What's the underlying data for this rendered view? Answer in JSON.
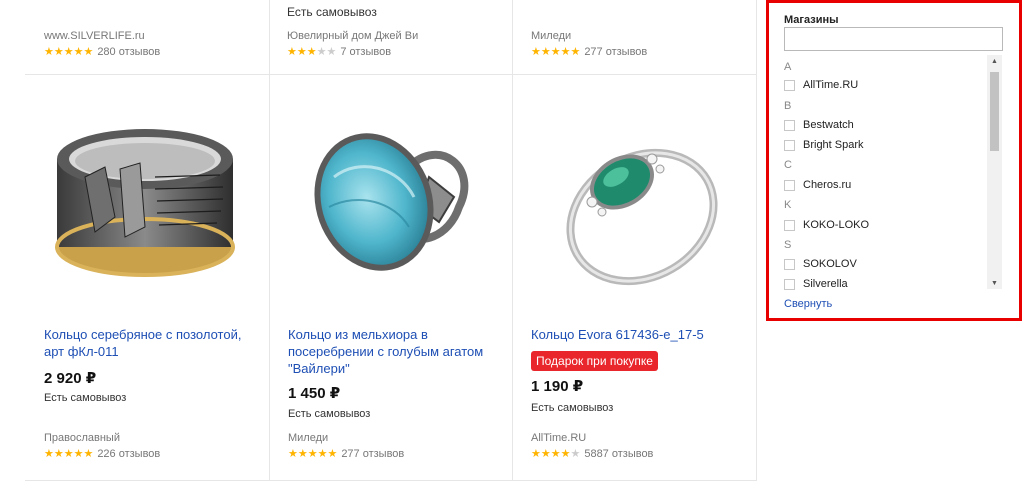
{
  "top_row": [
    {
      "pickup": "",
      "shop": "www.SILVERLIFE.ru",
      "stars": 5,
      "stars_text": "★★★★★",
      "stars_empty": "",
      "reviews": "280 отзывов"
    },
    {
      "pickup": "Есть самовывоз",
      "shop": "Ювелирный дом Джей Ви",
      "stars": 3,
      "stars_text": "★★★",
      "stars_empty": "★★",
      "reviews": "7 отзывов"
    },
    {
      "pickup": "",
      "shop": "Миледи",
      "stars": 5,
      "stars_text": "★★★★★",
      "stars_empty": "",
      "reviews": "277 отзывов"
    }
  ],
  "products": [
    {
      "title": "Кольцо серебряное с позолотой, арт фКл-011",
      "badge": "",
      "price": "2 920 ₽",
      "pickup": "Есть самовывоз",
      "shop": "Православный",
      "stars": 5,
      "stars_text": "★★★★★",
      "stars_empty": "",
      "reviews": "226 отзывов"
    },
    {
      "title": "Кольцо из мельхиора в посеребрении с голубым агатом \"Вайлери\"",
      "badge": "",
      "price": "1 450 ₽",
      "pickup": "Есть самовывоз",
      "shop": "Миледи",
      "stars": 5,
      "stars_text": "★★★★★",
      "stars_empty": "",
      "reviews": "277 отзывов"
    },
    {
      "title": "Кольцо Evora 617436-е_17-5",
      "badge": "Подарок при покупке",
      "price": "1 190 ₽",
      "pickup": "Есть самовывоз",
      "shop": "AllTime.RU",
      "stars": 4,
      "stars_text": "★★★★",
      "stars_empty": "★",
      "reviews": "5887 отзывов"
    }
  ],
  "filter": {
    "title": "Магазины",
    "search_value": "",
    "groups": [
      {
        "letter": "A",
        "options": [
          "AllTime.RU"
        ]
      },
      {
        "letter": "B",
        "options": [
          "Bestwatch",
          "Bright Spark"
        ]
      },
      {
        "letter": "C",
        "options": [
          "Cheros.ru"
        ]
      },
      {
        "letter": "K",
        "options": [
          "KOKO-LOKO"
        ]
      },
      {
        "letter": "S",
        "options": [
          "SOKOLOV",
          "Silverella"
        ]
      }
    ],
    "collapse_label": "Свернуть"
  },
  "colors": {
    "accent_red": "#e80000",
    "link_blue": "#1e4fb4",
    "star_gold": "#ffb400",
    "badge_red": "#e8262c"
  },
  "icons": {
    "scroll_up": "scroll-up-arrow-icon",
    "scroll_down": "scroll-down-arrow-icon",
    "star": "star-icon"
  }
}
